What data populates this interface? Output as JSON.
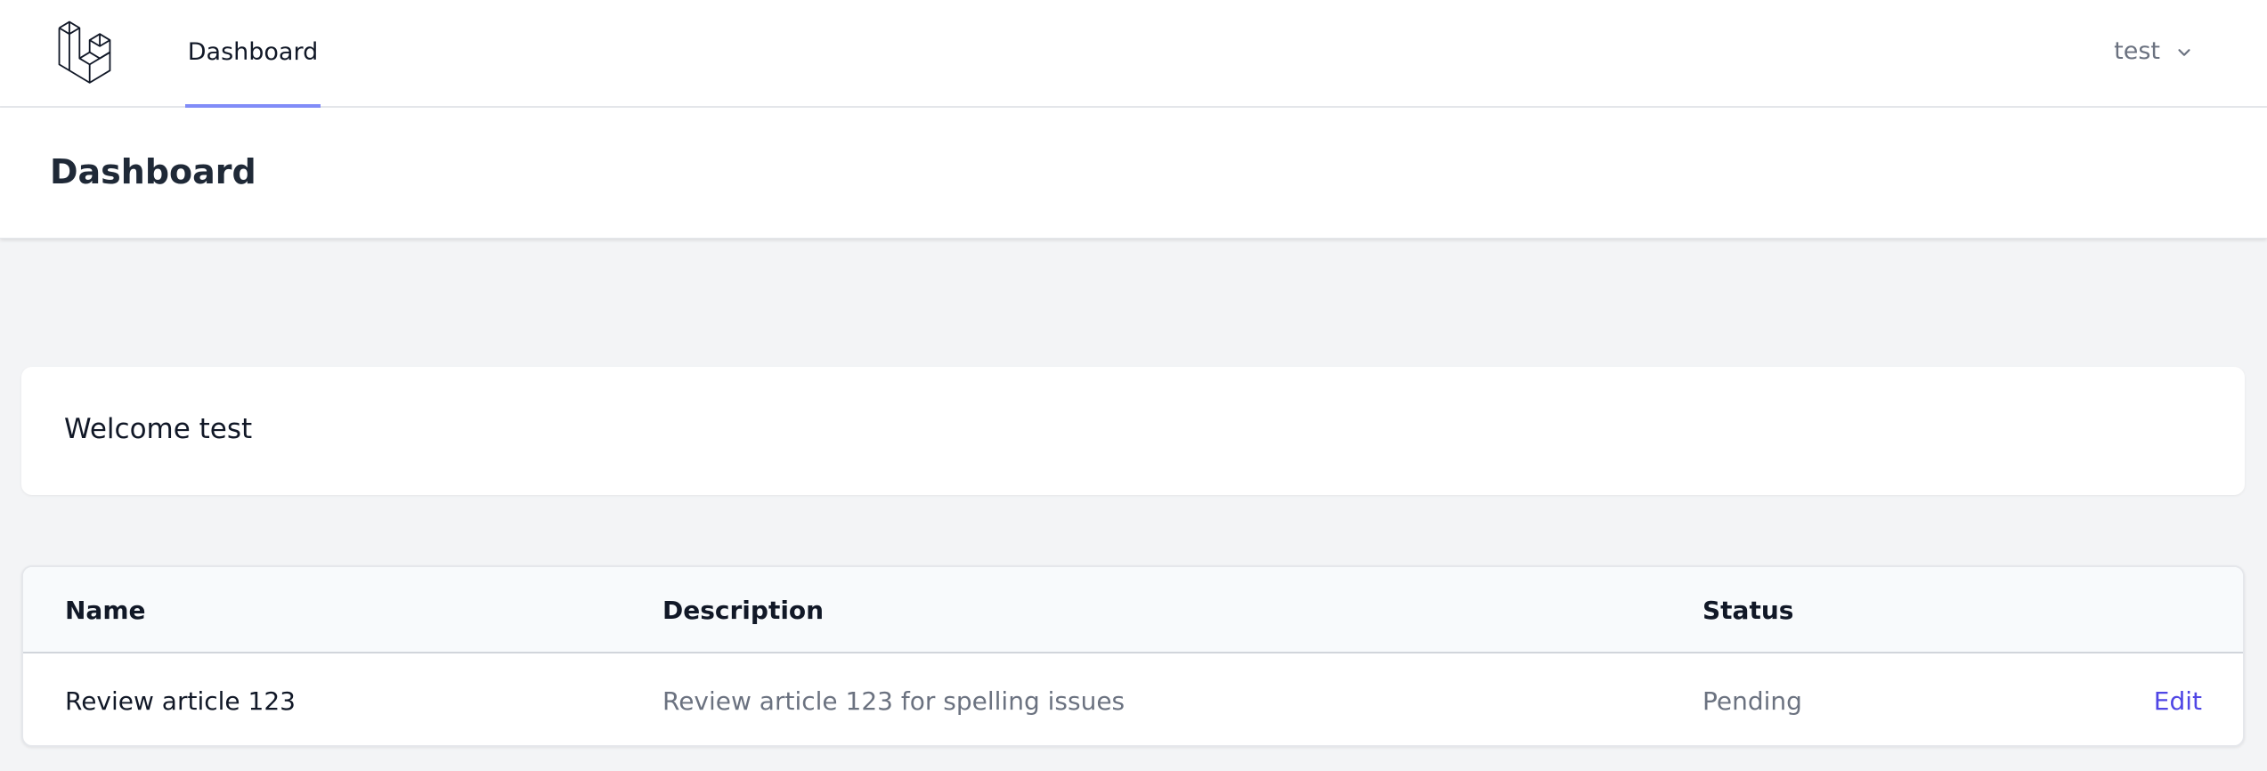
{
  "nav": {
    "logo_icon": "laravel-logo-icon",
    "links": [
      {
        "label": "Dashboard",
        "active": true
      }
    ],
    "active_indicator_color": "#818cf8",
    "user": {
      "name": "test",
      "icon": "chevron-down-icon"
    }
  },
  "header": {
    "title": "Dashboard"
  },
  "welcome": {
    "text": "Welcome test"
  },
  "table": {
    "columns": [
      "Name",
      "Description",
      "Status"
    ],
    "rows": [
      {
        "name": "Review article 123",
        "description": "Review article 123 for spelling issues",
        "status": "Pending",
        "action": "Edit"
      }
    ]
  },
  "colors": {
    "background": "#f3f4f6",
    "surface": "#ffffff",
    "link": "#4f46e5",
    "muted_text": "#6b7280"
  }
}
